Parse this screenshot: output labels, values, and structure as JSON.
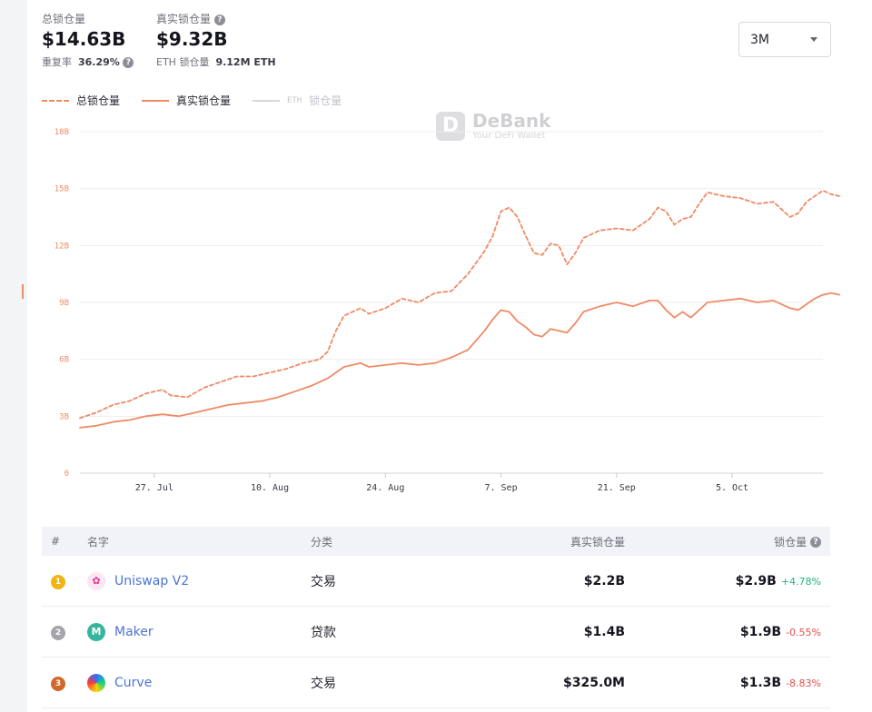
{
  "summary": {
    "total_label": "总锁仓量",
    "total_value": "$14.63B",
    "repeat_label": "重复率",
    "repeat_value": "36.29%",
    "real_label": "真实锁仓量",
    "real_value": "$9.32B",
    "eth_label": "ETH 锁仓量",
    "eth_value": "9.12M ETH"
  },
  "range_select": {
    "value": "3M"
  },
  "legend": {
    "total": "总锁仓量",
    "real": "真实锁仓量",
    "eth_prefix": "ETH",
    "eth": "锁仓量"
  },
  "watermark": {
    "name": "DeBank",
    "tagline": "Your DeFi Wallet"
  },
  "colors": {
    "accent": "#f08a65",
    "eth_line": "#d7d7dc",
    "positive": "#24b47e",
    "negative": "#e2504c"
  },
  "chart_data": {
    "type": "line",
    "ylim": [
      0,
      18
    ],
    "y_ticks": [
      0,
      3,
      6,
      9,
      12,
      15,
      18
    ],
    "y_tick_labels": [
      "0",
      "3B",
      "6B",
      "9B",
      "12B",
      "15B",
      "18B"
    ],
    "x_ticks": [
      {
        "x": 7,
        "label": "27. Jul"
      },
      {
        "x": 21,
        "label": "10. Aug"
      },
      {
        "x": 35,
        "label": "24. Aug"
      },
      {
        "x": 49,
        "label": "7. Sep"
      },
      {
        "x": 63,
        "label": "21. Sep"
      },
      {
        "x": 77,
        "label": "5. Oct"
      }
    ],
    "xlim": [
      -2,
      88
    ],
    "series": [
      {
        "name": "总锁仓量",
        "style": "dashed",
        "points": [
          [
            -2,
            2.9
          ],
          [
            0,
            3.2
          ],
          [
            2,
            3.6
          ],
          [
            4,
            3.8
          ],
          [
            6,
            4.2
          ],
          [
            8,
            4.4
          ],
          [
            9,
            4.1
          ],
          [
            11,
            4.0
          ],
          [
            13,
            4.5
          ],
          [
            15,
            4.8
          ],
          [
            17,
            5.1
          ],
          [
            19,
            5.1
          ],
          [
            21,
            5.3
          ],
          [
            23,
            5.5
          ],
          [
            25,
            5.8
          ],
          [
            27,
            6.0
          ],
          [
            28,
            6.4
          ],
          [
            29,
            7.5
          ],
          [
            30,
            8.3
          ],
          [
            32,
            8.7
          ],
          [
            33,
            8.4
          ],
          [
            35,
            8.7
          ],
          [
            37,
            9.2
          ],
          [
            39,
            9.0
          ],
          [
            41,
            9.5
          ],
          [
            43,
            9.6
          ],
          [
            45,
            10.5
          ],
          [
            47,
            11.7
          ],
          [
            48,
            12.5
          ],
          [
            49,
            13.8
          ],
          [
            50,
            14.0
          ],
          [
            51,
            13.5
          ],
          [
            52,
            12.5
          ],
          [
            53,
            11.6
          ],
          [
            54,
            11.5
          ],
          [
            55,
            12.1
          ],
          [
            56,
            12.0
          ],
          [
            57,
            11.0
          ],
          [
            58,
            11.6
          ],
          [
            59,
            12.4
          ],
          [
            61,
            12.8
          ],
          [
            63,
            12.9
          ],
          [
            65,
            12.8
          ],
          [
            67,
            13.4
          ],
          [
            68,
            14.0
          ],
          [
            69,
            13.8
          ],
          [
            70,
            13.1
          ],
          [
            71,
            13.4
          ],
          [
            72,
            13.5
          ],
          [
            73,
            14.2
          ],
          [
            74,
            14.8
          ],
          [
            76,
            14.6
          ],
          [
            78,
            14.5
          ],
          [
            80,
            14.2
          ],
          [
            82,
            14.3
          ],
          [
            84,
            13.5
          ],
          [
            85,
            13.7
          ],
          [
            86,
            14.3
          ],
          [
            87,
            14.6
          ],
          [
            88,
            14.9
          ],
          [
            89,
            14.7
          ],
          [
            90,
            14.6
          ]
        ]
      },
      {
        "name": "真实锁仓量",
        "style": "solid",
        "points": [
          [
            -2,
            2.4
          ],
          [
            0,
            2.5
          ],
          [
            2,
            2.7
          ],
          [
            4,
            2.8
          ],
          [
            6,
            3.0
          ],
          [
            8,
            3.1
          ],
          [
            10,
            3.0
          ],
          [
            12,
            3.2
          ],
          [
            14,
            3.4
          ],
          [
            16,
            3.6
          ],
          [
            18,
            3.7
          ],
          [
            20,
            3.8
          ],
          [
            22,
            4.0
          ],
          [
            24,
            4.3
          ],
          [
            26,
            4.6
          ],
          [
            28,
            5.0
          ],
          [
            30,
            5.6
          ],
          [
            32,
            5.8
          ],
          [
            33,
            5.6
          ],
          [
            35,
            5.7
          ],
          [
            37,
            5.8
          ],
          [
            39,
            5.7
          ],
          [
            41,
            5.8
          ],
          [
            43,
            6.1
          ],
          [
            45,
            6.5
          ],
          [
            47,
            7.5
          ],
          [
            48,
            8.1
          ],
          [
            49,
            8.6
          ],
          [
            50,
            8.5
          ],
          [
            51,
            8.0
          ],
          [
            52,
            7.7
          ],
          [
            53,
            7.3
          ],
          [
            54,
            7.2
          ],
          [
            55,
            7.6
          ],
          [
            56,
            7.5
          ],
          [
            57,
            7.4
          ],
          [
            58,
            7.9
          ],
          [
            59,
            8.5
          ],
          [
            61,
            8.8
          ],
          [
            63,
            9.0
          ],
          [
            65,
            8.8
          ],
          [
            67,
            9.1
          ],
          [
            68,
            9.1
          ],
          [
            69,
            8.6
          ],
          [
            70,
            8.2
          ],
          [
            71,
            8.5
          ],
          [
            72,
            8.2
          ],
          [
            73,
            8.6
          ],
          [
            74,
            9.0
          ],
          [
            76,
            9.1
          ],
          [
            78,
            9.2
          ],
          [
            80,
            9.0
          ],
          [
            82,
            9.1
          ],
          [
            84,
            8.7
          ],
          [
            85,
            8.6
          ],
          [
            86,
            8.9
          ],
          [
            87,
            9.2
          ],
          [
            88,
            9.4
          ],
          [
            89,
            9.5
          ],
          [
            90,
            9.4
          ]
        ]
      }
    ]
  },
  "table": {
    "headers": {
      "rank": "#",
      "name": "名字",
      "category": "分类",
      "real_tvl": "真实锁仓量",
      "tvl": "锁仓量"
    },
    "rows": [
      {
        "rank": "1",
        "name": "Uniswap V2",
        "icon": "unicorn-icon",
        "category": "交易",
        "real_tvl": "$2.2B",
        "tvl": "$2.9B",
        "change": "+4.78%",
        "dir": "pos"
      },
      {
        "rank": "2",
        "name": "Maker",
        "icon": "maker-icon",
        "category": "贷款",
        "real_tvl": "$1.4B",
        "tvl": "$1.9B",
        "change": "-0.55%",
        "dir": "neg"
      },
      {
        "rank": "3",
        "name": "Curve",
        "icon": "curve-icon",
        "category": "交易",
        "real_tvl": "$325.0M",
        "tvl": "$1.3B",
        "change": "-8.83%",
        "dir": "neg"
      }
    ]
  }
}
